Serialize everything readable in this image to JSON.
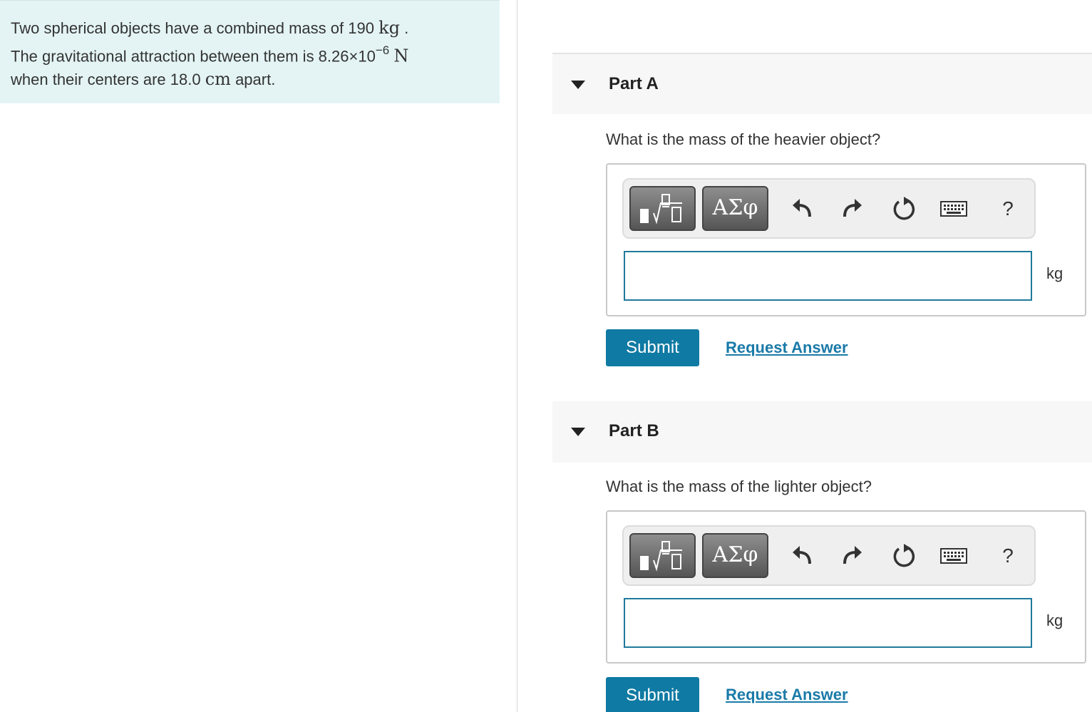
{
  "intro": {
    "line1_text": "Two spherical objects have a combined mass of 190",
    "line1_unit": "kg",
    "line1_end": ".",
    "line2_text": "The gravitational attraction between them is 8.26×10",
    "line2_exp": "−6",
    "line2_unit": "N",
    "line3_text": "when their centers are 18.0",
    "line3_unit": "cm",
    "line3_end": "apart."
  },
  "parts": [
    {
      "title": "Part A",
      "question": "What is the mass of the heavier object?",
      "symbols_label": "ΑΣφ",
      "help_label": "?",
      "answer_value": "",
      "unit": "kg",
      "submit_label": "Submit",
      "request_label": "Request Answer"
    },
    {
      "title": "Part B",
      "question": "What is the mass of the lighter object?",
      "symbols_label": "ΑΣφ",
      "help_label": "?",
      "answer_value": "",
      "unit": "kg",
      "submit_label": "Submit",
      "request_label": "Request Answer"
    }
  ],
  "icons": {
    "caret": "caret-down-icon",
    "templates": "math-templates-icon",
    "undo": "undo-icon",
    "redo": "redo-icon",
    "reset": "reset-icon",
    "keyboard": "keyboard-icon",
    "help": "help-icon"
  },
  "colors": {
    "intro_bg": "#e4f4f5",
    "accent": "#0f7aa3",
    "link": "#1a7aa8",
    "input_border": "#1f7a9c"
  }
}
